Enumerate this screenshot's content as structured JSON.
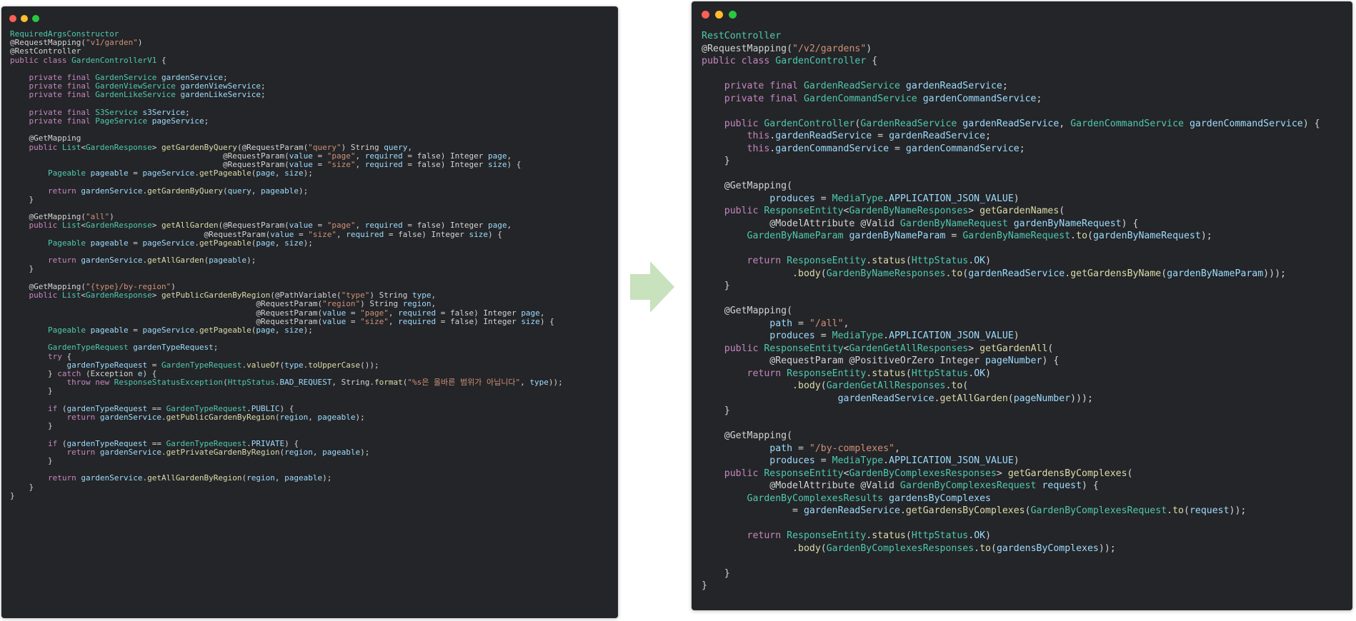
{
  "colors": {
    "editor_bg": "#242528",
    "default": "#d4d4d4",
    "keyword": "#c586c0",
    "type": "#4ec9b0",
    "variable": "#9cdcfe",
    "string": "#ce9178",
    "function": "#dcdcaa",
    "arrow": "#c8e2bd"
  },
  "left_code": [
    "RequiredArgsConstructor",
    "@RequestMapping(\"v1/garden\")",
    "@RestController",
    "public class GardenControllerV1 {",
    "",
    "    private final GardenService gardenService;",
    "    private final GardenViewService gardenViewService;",
    "    private final GardenLikeService gardenLikeService;",
    "",
    "    private final S3Service s3Service;",
    "    private final PageService pageService;",
    "",
    "    @GetMapping",
    "    public List<GardenResponse> getGardenByQuery(@RequestParam(\"query\") String query,",
    "                                             @RequestParam(value = \"page\", required = false) Integer page,",
    "                                             @RequestParam(value = \"size\", required = false) Integer size) {",
    "        Pageable pageable = pageService.getPageable(page, size);",
    "",
    "        return gardenService.getGardenByQuery(query, pageable);",
    "    }",
    "",
    "    @GetMapping(\"all\")",
    "    public List<GardenResponse> getAllGarden(@RequestParam(value = \"page\", required = false) Integer page,",
    "                                         @RequestParam(value = \"size\", required = false) Integer size) {",
    "        Pageable pageable = pageService.getPageable(page, size);",
    "",
    "        return gardenService.getAllGarden(pageable);",
    "    }",
    "",
    "    @GetMapping(\"{type}/by-region\")",
    "    public List<GardenResponse> getPublicGardenByRegion(@PathVariable(\"type\") String type,",
    "                                                    @RequestParam(\"region\") String region,",
    "                                                    @RequestParam(value = \"page\", required = false) Integer page,",
    "                                                    @RequestParam(value = \"size\", required = false) Integer size) {",
    "        Pageable pageable = pageService.getPageable(page, size);",
    "",
    "        GardenTypeRequest gardenTypeRequest;",
    "        try {",
    "            gardenTypeRequest = GardenTypeRequest.valueOf(type.toUpperCase());",
    "        } catch (Exception e) {",
    "            throw new ResponseStatusException(HttpStatus.BAD_REQUEST, String.format(\"%s은 올바른 범위가 아닙니다\", type));",
    "        }",
    "",
    "        if (gardenTypeRequest == GardenTypeRequest.PUBLIC) {",
    "            return gardenService.getPublicGardenByRegion(region, pageable);",
    "        }",
    "",
    "        if (gardenTypeRequest == GardenTypeRequest.PRIVATE) {",
    "            return gardenService.getPrivateGardenByRegion(region, pageable);",
    "        }",
    "",
    "        return gardenService.getAllGardenByRegion(region, pageable);",
    "    }",
    "}"
  ],
  "right_code": [
    "RestController",
    "@RequestMapping(\"/v2/gardens\")",
    "public class GardenController {",
    "",
    "    private final GardenReadService gardenReadService;",
    "    private final GardenCommandService gardenCommandService;",
    "",
    "    public GardenController(GardenReadService gardenReadService, GardenCommandService gardenCommandService) {",
    "        this.gardenReadService = gardenReadService;",
    "        this.gardenCommandService = gardenCommandService;",
    "    }",
    "",
    "    @GetMapping(",
    "            produces = MediaType.APPLICATION_JSON_VALUE)",
    "    public ResponseEntity<GardenByNameResponses> getGardenNames(",
    "            @ModelAttribute @Valid GardenByNameRequest gardenByNameRequest) {",
    "        GardenByNameParam gardenByNameParam = GardenByNameRequest.to(gardenByNameRequest);",
    "",
    "        return ResponseEntity.status(HttpStatus.OK)",
    "                .body(GardenByNameResponses.to(gardenReadService.getGardensByName(gardenByNameParam)));",
    "    }",
    "",
    "    @GetMapping(",
    "            path = \"/all\",",
    "            produces = MediaType.APPLICATION_JSON_VALUE)",
    "    public ResponseEntity<GardenGetAllResponses> getGardenAll(",
    "            @RequestParam @PositiveOrZero Integer pageNumber) {",
    "        return ResponseEntity.status(HttpStatus.OK)",
    "                .body(GardenGetAllResponses.to(",
    "                        gardenReadService.getAllGarden(pageNumber)));",
    "    }",
    "",
    "    @GetMapping(",
    "            path = \"/by-complexes\",",
    "            produces = MediaType.APPLICATION_JSON_VALUE)",
    "    public ResponseEntity<GardenByComplexesResponses> getGardensByComplexes(",
    "            @ModelAttribute @Valid GardenByComplexesRequest request) {",
    "        GardenByComplexesResults gardensByComplexes",
    "                = gardenReadService.getGardensByComplexes(GardenByComplexesRequest.to(request));",
    "",
    "        return ResponseEntity.status(HttpStatus.OK)",
    "                .body(GardenByComplexesResponses.to(gardensByComplexes));",
    "",
    "    }",
    "}"
  ]
}
